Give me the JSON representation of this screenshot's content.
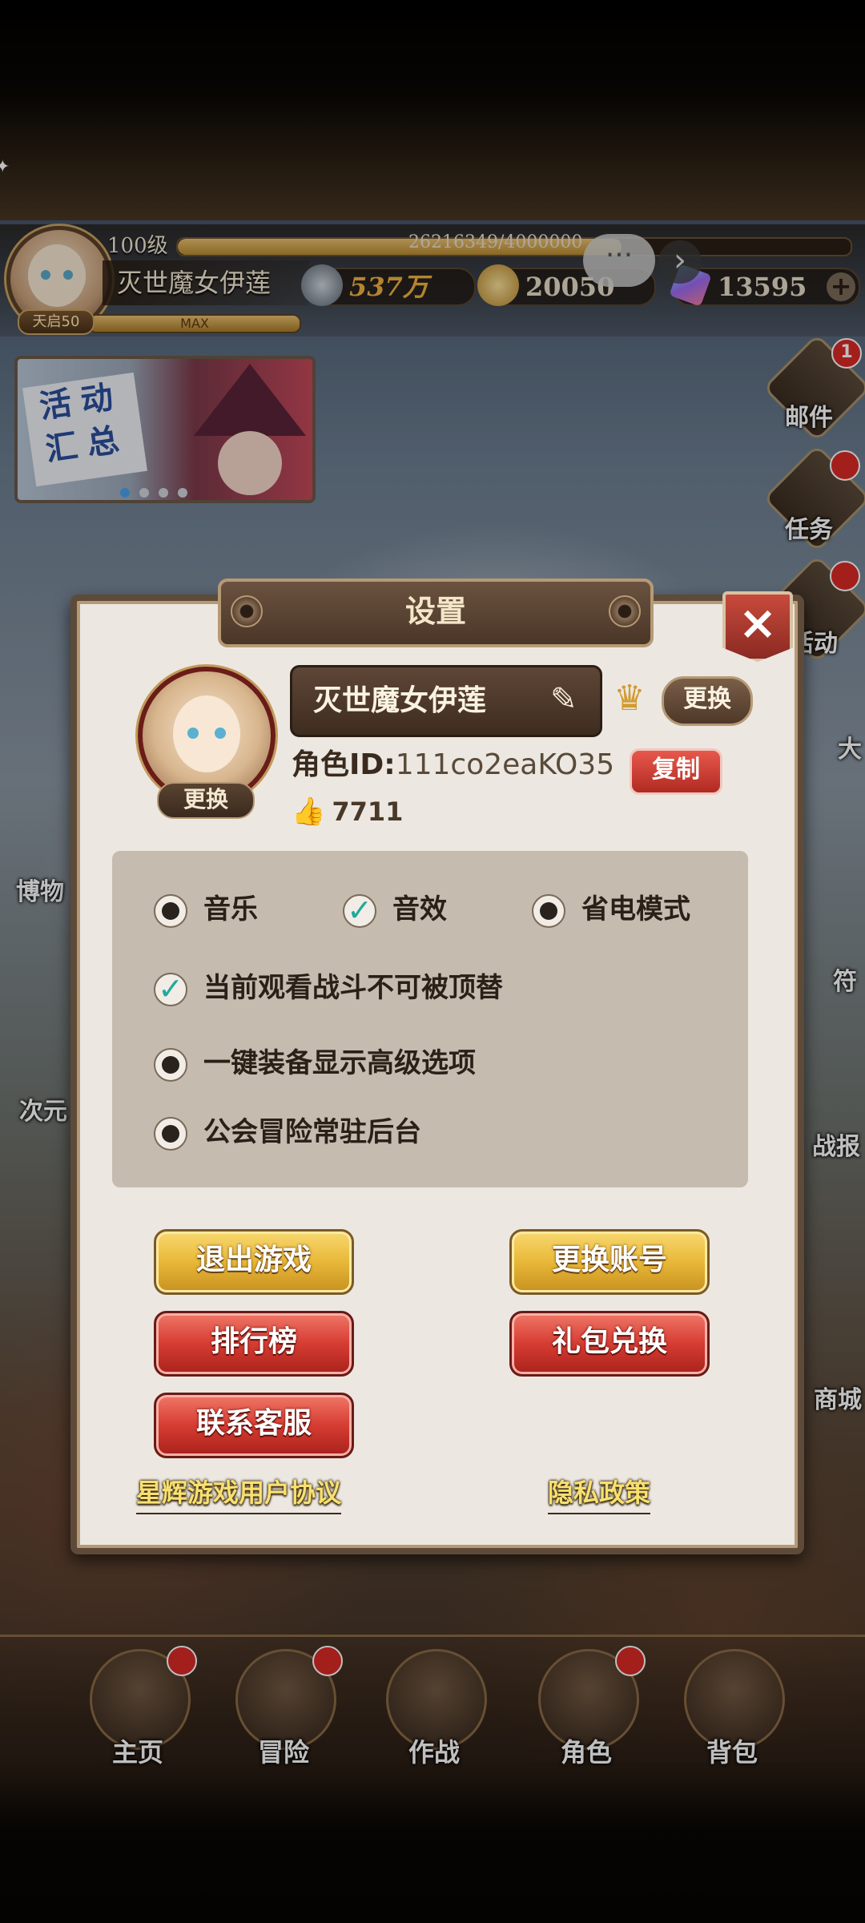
{
  "hud": {
    "level": "100级",
    "exp_text": "26216349/4000000",
    "exp_progress": 0.66,
    "player_name": "灭世魔女伊莲",
    "tianqi_badge": "天启50",
    "max_label": "MAX",
    "power": "537万",
    "gold": "20050",
    "gems": "13595",
    "plus": "+",
    "chat_icon": "···",
    "arrow_icon": "›"
  },
  "event_banner": {
    "text": "活动汇总",
    "page_count": 4,
    "active_page": 0
  },
  "side_menu": {
    "mail": {
      "label": "邮件",
      "badge": "1"
    },
    "tasks": {
      "label": "任务"
    },
    "activity": {
      "label": "活动"
    },
    "edge_labels": [
      "大",
      "符",
      "战报",
      "商城",
      "博物",
      "次元"
    ]
  },
  "bottom_nav": [
    {
      "label": "主页"
    },
    {
      "label": "冒险"
    },
    {
      "label": "作战"
    },
    {
      "label": "角色"
    },
    {
      "label": "背包"
    }
  ],
  "dialog": {
    "title": "设置",
    "close_icon": "×",
    "avatar_change_label": "更换",
    "player_name": "灭世魔女伊莲",
    "edit_icon": "✎",
    "title_emblem": "♛",
    "title_change_label": "更换",
    "role_id_label": "角色ID:",
    "role_id_value": "111co2eaKO35",
    "copy_label": "复制",
    "like_icon": "👍",
    "likes": "7711",
    "options": {
      "music": {
        "label": "音乐",
        "checked": false
      },
      "sfx": {
        "label": "音效",
        "checked": true
      },
      "power_save": {
        "label": "省电模式",
        "checked": false
      },
      "battle_watch": {
        "label": "当前观看战斗不可被顶替",
        "checked": true
      },
      "equip_advanced": {
        "label": "一键装备显示高级选项",
        "checked": false
      },
      "guild_background": {
        "label": "公会冒险常驻后台",
        "checked": false
      }
    },
    "buttons": {
      "exit_game": "退出游戏",
      "switch_account": "更换账号",
      "leaderboard": "排行榜",
      "gift_redeem": "礼包兑换",
      "contact_support": "联系客服"
    },
    "links": {
      "user_agreement": "星辉游戏用户协议",
      "privacy_policy": "隐私政策"
    },
    "colors": {
      "gold_button": "#e8b838",
      "red_button": "#d63c32",
      "check_accent": "#23a99a",
      "link_color": "#f8e070"
    }
  }
}
